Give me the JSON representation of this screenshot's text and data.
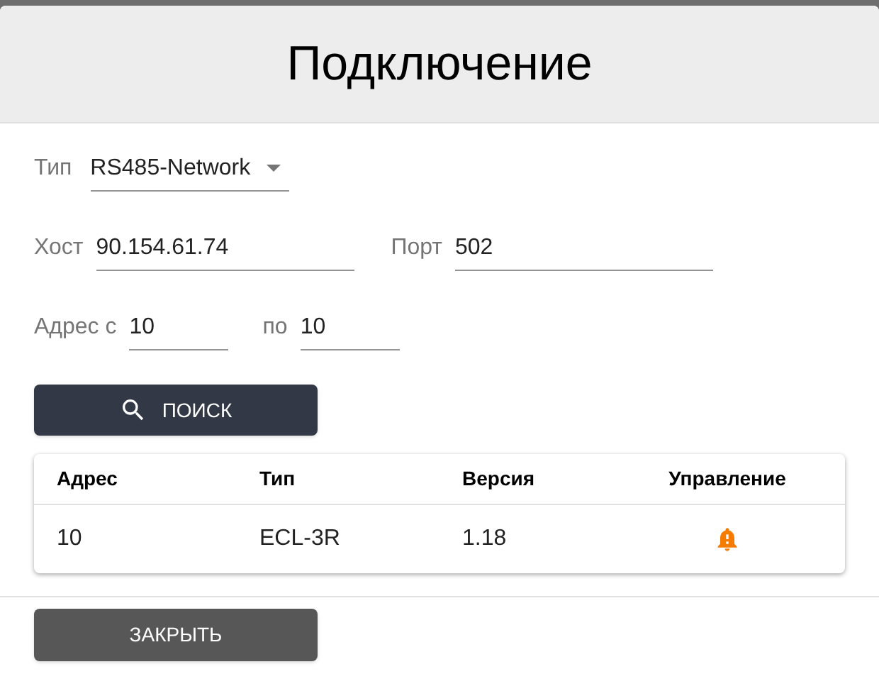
{
  "dialog": {
    "title": "Подключение"
  },
  "type_field": {
    "label": "Тип",
    "value": "RS485-Network"
  },
  "host_field": {
    "label": "Хост",
    "value": "90.154.61.74"
  },
  "port_field": {
    "label": "Порт",
    "value": "502"
  },
  "address_from": {
    "label": "Адрес с",
    "value": "10"
  },
  "address_to": {
    "label": "по",
    "value": "10"
  },
  "search_button": {
    "label": "ПОИСК"
  },
  "table": {
    "columns": [
      "Адрес",
      "Тип",
      "Версия",
      "Управление"
    ],
    "rows": [
      {
        "cells": [
          "10",
          "ECL-3R",
          "1.18"
        ]
      }
    ]
  },
  "close_button": {
    "label": "ЗАКРЫТЬ"
  }
}
